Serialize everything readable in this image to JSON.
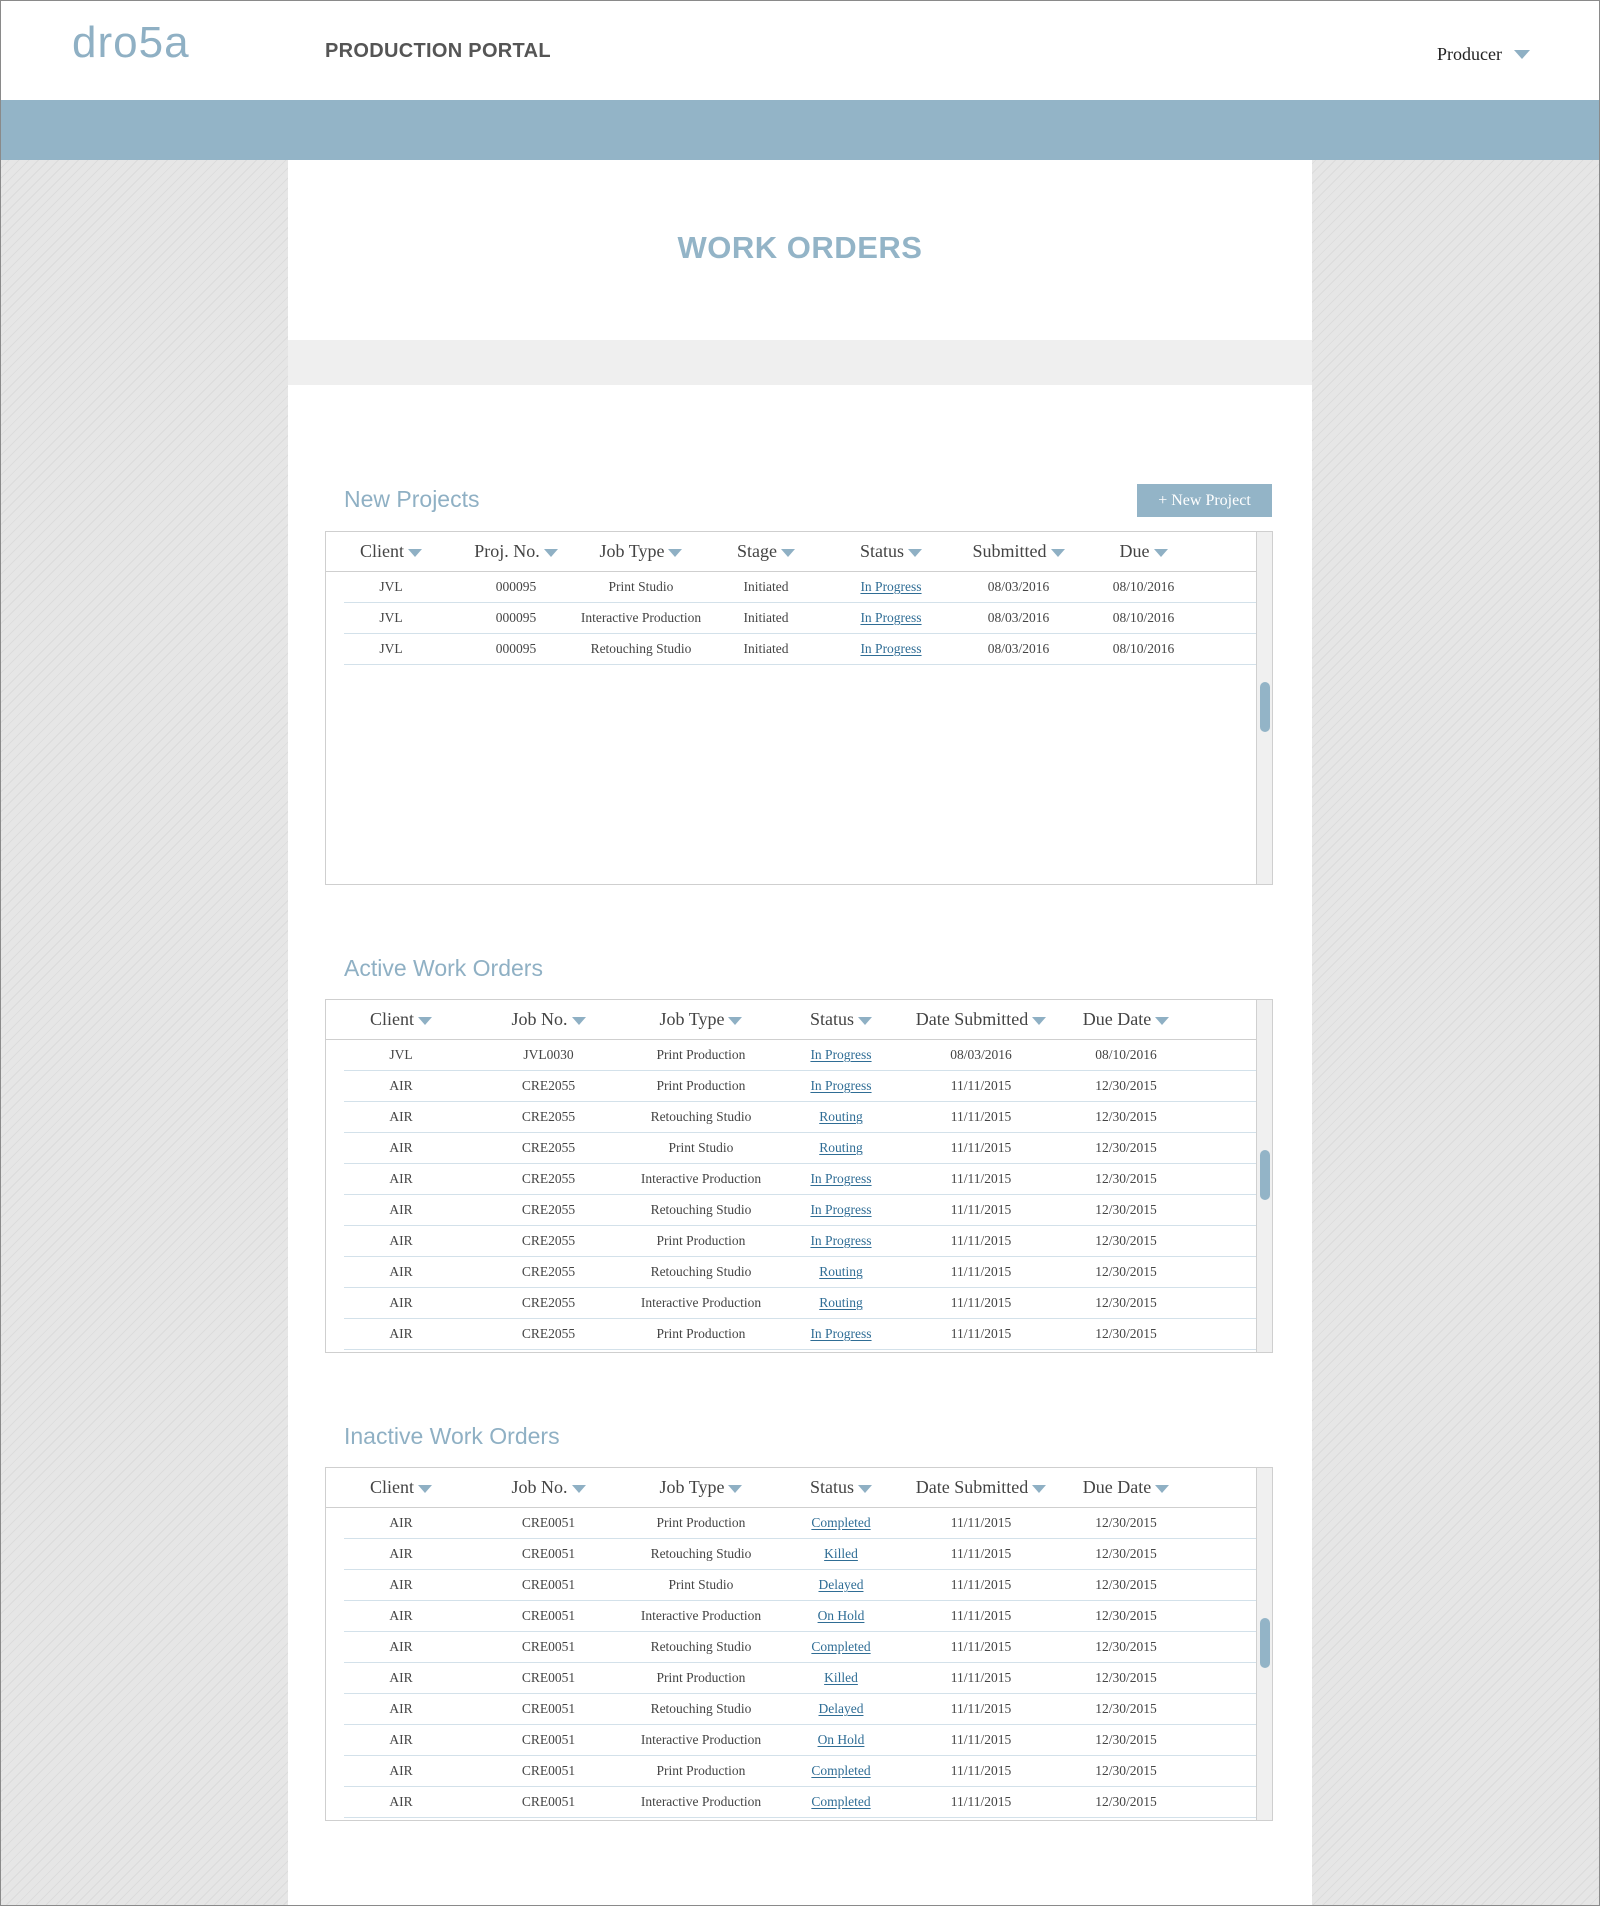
{
  "header": {
    "logo_text": "dro5a",
    "app_title": "PRODUCTION PORTAL",
    "user_role": "Producer"
  },
  "page": {
    "title": "WORK ORDERS"
  },
  "new_projects": {
    "title": "New Projects",
    "button_label": "+ New Project",
    "columns": [
      "Client",
      "Proj. No.",
      "Job Type",
      "Stage",
      "Status",
      "Submitted",
      "Due"
    ],
    "rows": [
      [
        "JVL",
        "000095",
        "Print Studio",
        "Initiated",
        "In Progress",
        "08/03/2016",
        "08/10/2016"
      ],
      [
        "JVL",
        "000095",
        "Interactive Production",
        "Initiated",
        "In Progress",
        "08/03/2016",
        "08/10/2016"
      ],
      [
        "JVL",
        "000095",
        "Retouching Studio",
        "Initiated",
        "In Progress",
        "08/03/2016",
        "08/10/2016"
      ]
    ]
  },
  "active_orders": {
    "title": "Active Work Orders",
    "columns": [
      "Client",
      "Job No.",
      "Job Type",
      "Status",
      "Date Submitted",
      "Due Date"
    ],
    "rows": [
      [
        "JVL",
        "JVL0030",
        "Print Production",
        "In Progress",
        "08/03/2016",
        "08/10/2016"
      ],
      [
        "AIR",
        "CRE2055",
        "Print Production",
        "In Progress",
        "11/11/2015",
        "12/30/2015"
      ],
      [
        "AIR",
        "CRE2055",
        "Retouching Studio",
        "Routing",
        "11/11/2015",
        "12/30/2015"
      ],
      [
        "AIR",
        "CRE2055",
        "Print Studio",
        "Routing",
        "11/11/2015",
        "12/30/2015"
      ],
      [
        "AIR",
        "CRE2055",
        "Interactive Production",
        "In Progress",
        "11/11/2015",
        "12/30/2015"
      ],
      [
        "AIR",
        "CRE2055",
        "Retouching Studio",
        "In Progress",
        "11/11/2015",
        "12/30/2015"
      ],
      [
        "AIR",
        "CRE2055",
        "Print Production",
        "In Progress",
        "11/11/2015",
        "12/30/2015"
      ],
      [
        "AIR",
        "CRE2055",
        "Retouching Studio",
        "Routing",
        "11/11/2015",
        "12/30/2015"
      ],
      [
        "AIR",
        "CRE2055",
        "Interactive Production",
        "Routing",
        "11/11/2015",
        "12/30/2015"
      ],
      [
        "AIR",
        "CRE2055",
        "Print Production",
        "In Progress",
        "11/11/2015",
        "12/30/2015"
      ]
    ]
  },
  "inactive_orders": {
    "title": "Inactive Work Orders",
    "columns": [
      "Client",
      "Job No.",
      "Job Type",
      "Status",
      "Date Submitted",
      "Due Date"
    ],
    "rows": [
      [
        "AIR",
        "CRE0051",
        "Print Production",
        "Completed",
        "11/11/2015",
        "12/30/2015"
      ],
      [
        "AIR",
        "CRE0051",
        "Retouching Studio",
        "Killed",
        "11/11/2015",
        "12/30/2015"
      ],
      [
        "AIR",
        "CRE0051",
        "Print Studio",
        "Delayed",
        "11/11/2015",
        "12/30/2015"
      ],
      [
        "AIR",
        "CRE0051",
        "Interactive Production",
        "On Hold",
        "11/11/2015",
        "12/30/2015"
      ],
      [
        "AIR",
        "CRE0051",
        "Retouching Studio",
        "Completed",
        "11/11/2015",
        "12/30/2015"
      ],
      [
        "AIR",
        "CRE0051",
        "Print Production",
        "Killed",
        "11/11/2015",
        "12/30/2015"
      ],
      [
        "AIR",
        "CRE0051",
        "Retouching Studio",
        "Delayed",
        "11/11/2015",
        "12/30/2015"
      ],
      [
        "AIR",
        "CRE0051",
        "Interactive Production",
        "On Hold",
        "11/11/2015",
        "12/30/2015"
      ],
      [
        "AIR",
        "CRE0051",
        "Print Production",
        "Completed",
        "11/11/2015",
        "12/30/2015"
      ],
      [
        "AIR",
        "CRE0051",
        "Interactive Production",
        "Completed",
        "11/11/2015",
        "12/30/2015"
      ]
    ]
  },
  "colors": {
    "accent": "#93b4c7",
    "link": "#2f6d95",
    "row_divider": "#d3e1ea"
  },
  "icons": {
    "sort": "caret-down-icon",
    "user_menu": "chevron-down-icon"
  }
}
